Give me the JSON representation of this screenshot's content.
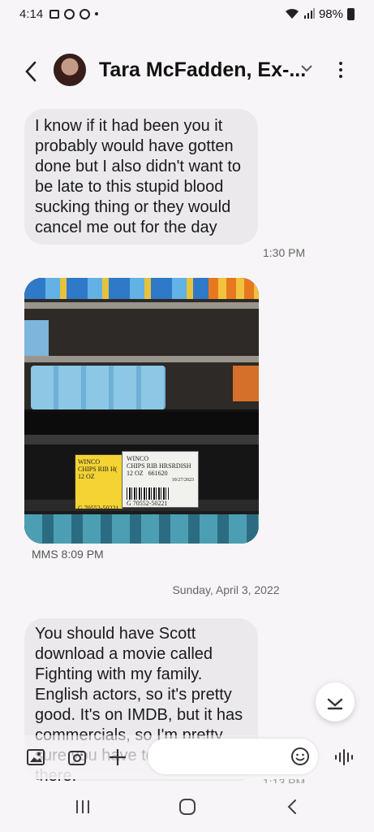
{
  "status_bar": {
    "time": "4:14",
    "battery": "98%"
  },
  "header": {
    "contact_name": "Tara McFadden, Ex-..."
  },
  "messages": [
    {
      "text": "I know if it had been you it probably would have gotten done but I also didn't want to be late to this stupid blood sucking thing or they would cancel me out for the day",
      "time": "1:30 PM"
    },
    {
      "type": "mms",
      "label": "MMS 8:09 PM",
      "price_tags": [
        {
          "store": "WINCO",
          "item": "CHIPS RIB H(",
          "size": "12 OZ",
          "code": "G 70552-50221"
        },
        {
          "store": "WINCO",
          "item": "CHIPS RIB HRSRDISH",
          "size": "12 OZ",
          "number": "661620",
          "date": "10/27/2023",
          "code": "G 70552-50221"
        }
      ]
    },
    {
      "text": "You should have Scott download a movie called Fighting with my family. English actors, so it's pretty good. It's on IMDB, but it has commercials, so I'm pretty sure you have to watch it there.",
      "time": "1:13 PM"
    }
  ],
  "date_separator": "Sunday, April 3, 2022",
  "composer": {
    "placeholder": ""
  },
  "colors": {
    "bubble": "#ebe9ec",
    "background": "#f7f5f7"
  }
}
